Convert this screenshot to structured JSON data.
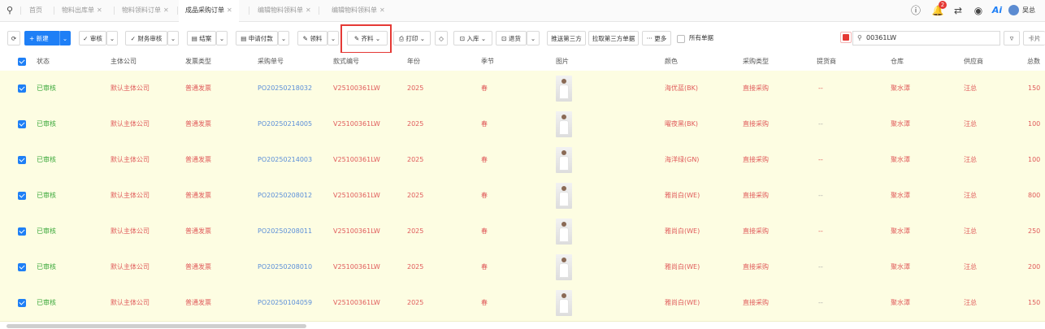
{
  "tabs": [
    {
      "label": "首页",
      "closable": false,
      "active": false
    },
    {
      "label": "物料出库单",
      "closable": true,
      "active": false
    },
    {
      "label": "物料领料订单",
      "closable": true,
      "active": false
    },
    {
      "label": "成品采购订单",
      "closable": true,
      "active": true
    },
    {
      "label": "编辑物料领料单",
      "closable": true,
      "active": false
    },
    {
      "label": "编辑物料领料单",
      "closable": true,
      "active": false
    }
  ],
  "header": {
    "user": "吴总",
    "notification_count": "2",
    "ai_label": "Ai"
  },
  "toolbar": {
    "new_label": "+ 新建",
    "approve_label": "✓ 审核",
    "finance_label": "✓ 财务审核",
    "settle_label": "▤ 结案",
    "payment_label": "▤ 申请付款",
    "pick_label": "✎ 领料",
    "kit_label": "✎ 齐料",
    "print_label": "⎙ 打印",
    "inbound_label": "⊡ 入库",
    "return_label": "⊡ 退货",
    "push_label": "推送第三方",
    "pull_label": "拉取第三方单据",
    "more_label": "··· 更多",
    "all_label": "所有单据",
    "search_value": "00361LW",
    "card_label": "卡片"
  },
  "columns": [
    "状态",
    "主体公司",
    "发票类型",
    "采购单号",
    "款式编号",
    "年份",
    "季节",
    "图片",
    "颜色",
    "采购类型",
    "提货商",
    "仓库",
    "供应商",
    "总数"
  ],
  "rows": [
    {
      "status": "已审核",
      "company": "默认主体公司",
      "invoice": "普通发票",
      "po": "PO20250218032",
      "style": "V25100361LW",
      "year": "2025",
      "season": "春",
      "color": "海优蓝(BK)",
      "ptype": "直接采购",
      "pickup": "--",
      "warehouse": "聚水潭",
      "supplier": "汪总",
      "total": "150"
    },
    {
      "status": "已审核",
      "company": "默认主体公司",
      "invoice": "普通发票",
      "po": "PO20250214005",
      "style": "V25100361LW",
      "year": "2025",
      "season": "春",
      "color": "曜夜黑(BK)",
      "ptype": "直接采购",
      "pickup": "--",
      "warehouse": "聚水潭",
      "supplier": "汪总",
      "total": "100"
    },
    {
      "status": "已审核",
      "company": "默认主体公司",
      "invoice": "普通发票",
      "po": "PO20250214003",
      "style": "V25100361LW",
      "year": "2025",
      "season": "春",
      "color": "海洋绿(GN)",
      "ptype": "直接采购",
      "pickup": "--",
      "warehouse": "聚水潭",
      "supplier": "汪总",
      "total": "100"
    },
    {
      "status": "已审核",
      "company": "默认主体公司",
      "invoice": "普通发票",
      "po": "PO20250208012",
      "style": "V25100361LW",
      "year": "2025",
      "season": "春",
      "color": "雅尚白(WE)",
      "ptype": "直接采购",
      "pickup": "--",
      "warehouse": "聚水潭",
      "supplier": "汪总",
      "total": "800"
    },
    {
      "status": "已审核",
      "company": "默认主体公司",
      "invoice": "普通发票",
      "po": "PO20250208011",
      "style": "V25100361LW",
      "year": "2025",
      "season": "春",
      "color": "雅尚白(WE)",
      "ptype": "直接采购",
      "pickup": "--",
      "warehouse": "聚水潭",
      "supplier": "汪总",
      "total": "250"
    },
    {
      "status": "已审核",
      "company": "默认主体公司",
      "invoice": "普通发票",
      "po": "PO20250208010",
      "style": "V25100361LW",
      "year": "2025",
      "season": "春",
      "color": "雅尚白(WE)",
      "ptype": "直接采购",
      "pickup": "--",
      "warehouse": "聚水潭",
      "supplier": "汪总",
      "total": "200"
    },
    {
      "status": "已审核",
      "company": "默认主体公司",
      "invoice": "普通发票",
      "po": "PO20250104059",
      "style": "V25100361LW",
      "year": "2025",
      "season": "春",
      "color": "雅尚白(WE)",
      "ptype": "直接采购",
      "pickup": "--",
      "warehouse": "聚水潭",
      "supplier": "汪总",
      "total": "150"
    }
  ],
  "colors": {
    "accent": "#1e7ff6",
    "row_bg": "#fdfde2",
    "status": "#3aa83a",
    "value": "#e05a5a",
    "link": "#5a8ed8",
    "highlight": "#e53935"
  }
}
